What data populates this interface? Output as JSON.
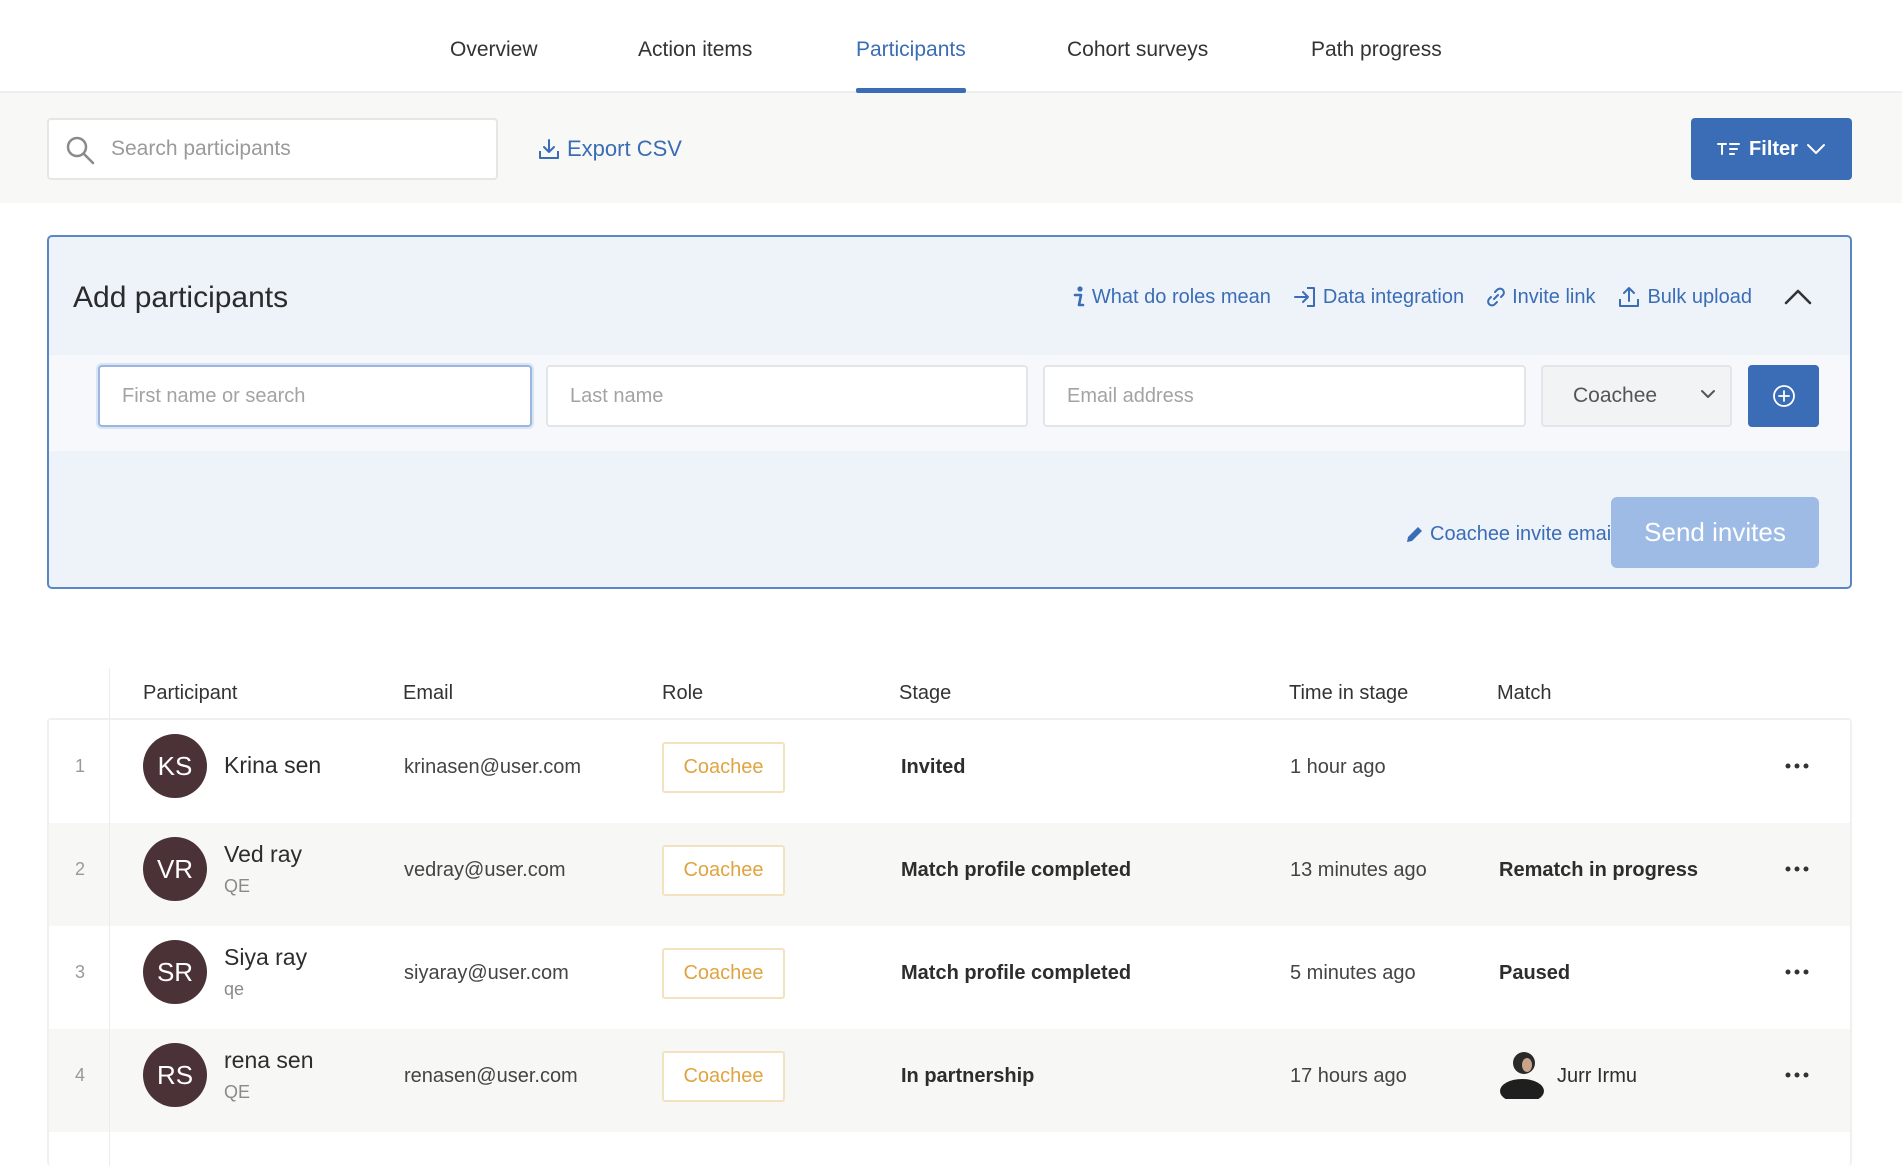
{
  "tabs": [
    {
      "label": "Overview",
      "active": false
    },
    {
      "label": "Action items",
      "active": false
    },
    {
      "label": "Participants",
      "active": true
    },
    {
      "label": "Cohort surveys",
      "active": false
    },
    {
      "label": "Path progress",
      "active": false
    }
  ],
  "toolbar": {
    "search_placeholder": "Search participants",
    "export_label": "Export CSV",
    "filter_label": "Filter"
  },
  "add_panel": {
    "title": "Add participants",
    "links": {
      "roles": "What do roles mean",
      "data_integration": "Data integration",
      "invite_link": "Invite link",
      "bulk_upload": "Bulk upload"
    },
    "first_name_placeholder": "First name or search",
    "last_name_placeholder": "Last name",
    "email_placeholder": "Email address",
    "role_selected": "Coachee",
    "invite_email_label": "Coachee invite email",
    "send_label": "Send invites"
  },
  "table": {
    "columns": {
      "participant": "Participant",
      "email": "Email",
      "role": "Role",
      "stage": "Stage",
      "time": "Time in stage",
      "match": "Match"
    },
    "rows": [
      {
        "index": "1",
        "initials": "KS",
        "name": "Krina sen",
        "sub": "",
        "email": "krinasen@user.com",
        "role": "Coachee",
        "stage": "Invited",
        "time": "1 hour ago",
        "match": ""
      },
      {
        "index": "2",
        "initials": "VR",
        "name": "Ved ray",
        "sub": "QE",
        "email": "vedray@user.com",
        "role": "Coachee",
        "stage": "Match profile completed",
        "time": "13 minutes ago",
        "match": "Rematch in progress"
      },
      {
        "index": "3",
        "initials": "SR",
        "name": "Siya ray",
        "sub": "qe",
        "email": "siyaray@user.com",
        "role": "Coachee",
        "stage": "Match profile completed",
        "time": "5 minutes ago",
        "match": "Paused"
      },
      {
        "index": "4",
        "initials": "RS",
        "name": "rena sen",
        "sub": "QE",
        "email": "renasen@user.com",
        "role": "Coachee",
        "stage": "In partnership",
        "time": "17 hours ago",
        "match": "Jurr Irmu"
      }
    ]
  },
  "colors": {
    "accent": "#3a6db5",
    "send_disabled": "#9ebbe6",
    "badge_text": "#e0a441",
    "avatar_bg": "#4a3236"
  }
}
